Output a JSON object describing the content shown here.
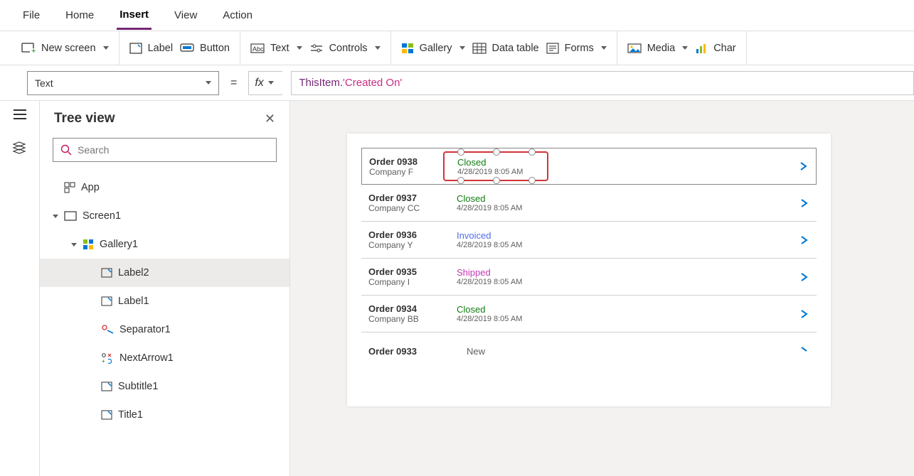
{
  "menubar": {
    "items": [
      "File",
      "Home",
      "Insert",
      "View",
      "Action"
    ],
    "active": 2
  },
  "ribbon": {
    "newscreen": "New screen",
    "label": "Label",
    "button": "Button",
    "text": "Text",
    "controls": "Controls",
    "gallery": "Gallery",
    "datatable": "Data table",
    "forms": "Forms",
    "media": "Media",
    "charts": "Char"
  },
  "formula": {
    "property": "Text",
    "expr_this": "ThisItem",
    "expr_dot": ".",
    "expr_prop": "'Created On'"
  },
  "panel": {
    "title": "Tree view",
    "search_placeholder": "Search",
    "nodes": {
      "app": "App",
      "screen1": "Screen1",
      "gallery1": "Gallery1",
      "label2": "Label2",
      "label1": "Label1",
      "separator1": "Separator1",
      "nextarrow1": "NextArrow1",
      "subtitle1": "Subtitle1",
      "title1": "Title1"
    }
  },
  "gallery": {
    "rows": [
      {
        "title": "Order 0938",
        "subtitle": "Company F",
        "status": "Closed",
        "status_class": "st-closed",
        "date": "4/28/2019 8:05 AM"
      },
      {
        "title": "Order 0937",
        "subtitle": "Company CC",
        "status": "Closed",
        "status_class": "st-closed",
        "date": "4/28/2019 8:05 AM"
      },
      {
        "title": "Order 0936",
        "subtitle": "Company Y",
        "status": "Invoiced",
        "status_class": "st-invoiced",
        "date": "4/28/2019 8:05 AM"
      },
      {
        "title": "Order 0935",
        "subtitle": "Company I",
        "status": "Shipped",
        "status_class": "st-shipped",
        "date": "4/28/2019 8:05 AM"
      },
      {
        "title": "Order 0934",
        "subtitle": "Company BB",
        "status": "Closed",
        "status_class": "st-closed",
        "date": "4/28/2019 8:05 AM"
      },
      {
        "title": "Order 0933",
        "subtitle": "",
        "status": "New",
        "status_class": "st-new",
        "date": ""
      }
    ]
  }
}
